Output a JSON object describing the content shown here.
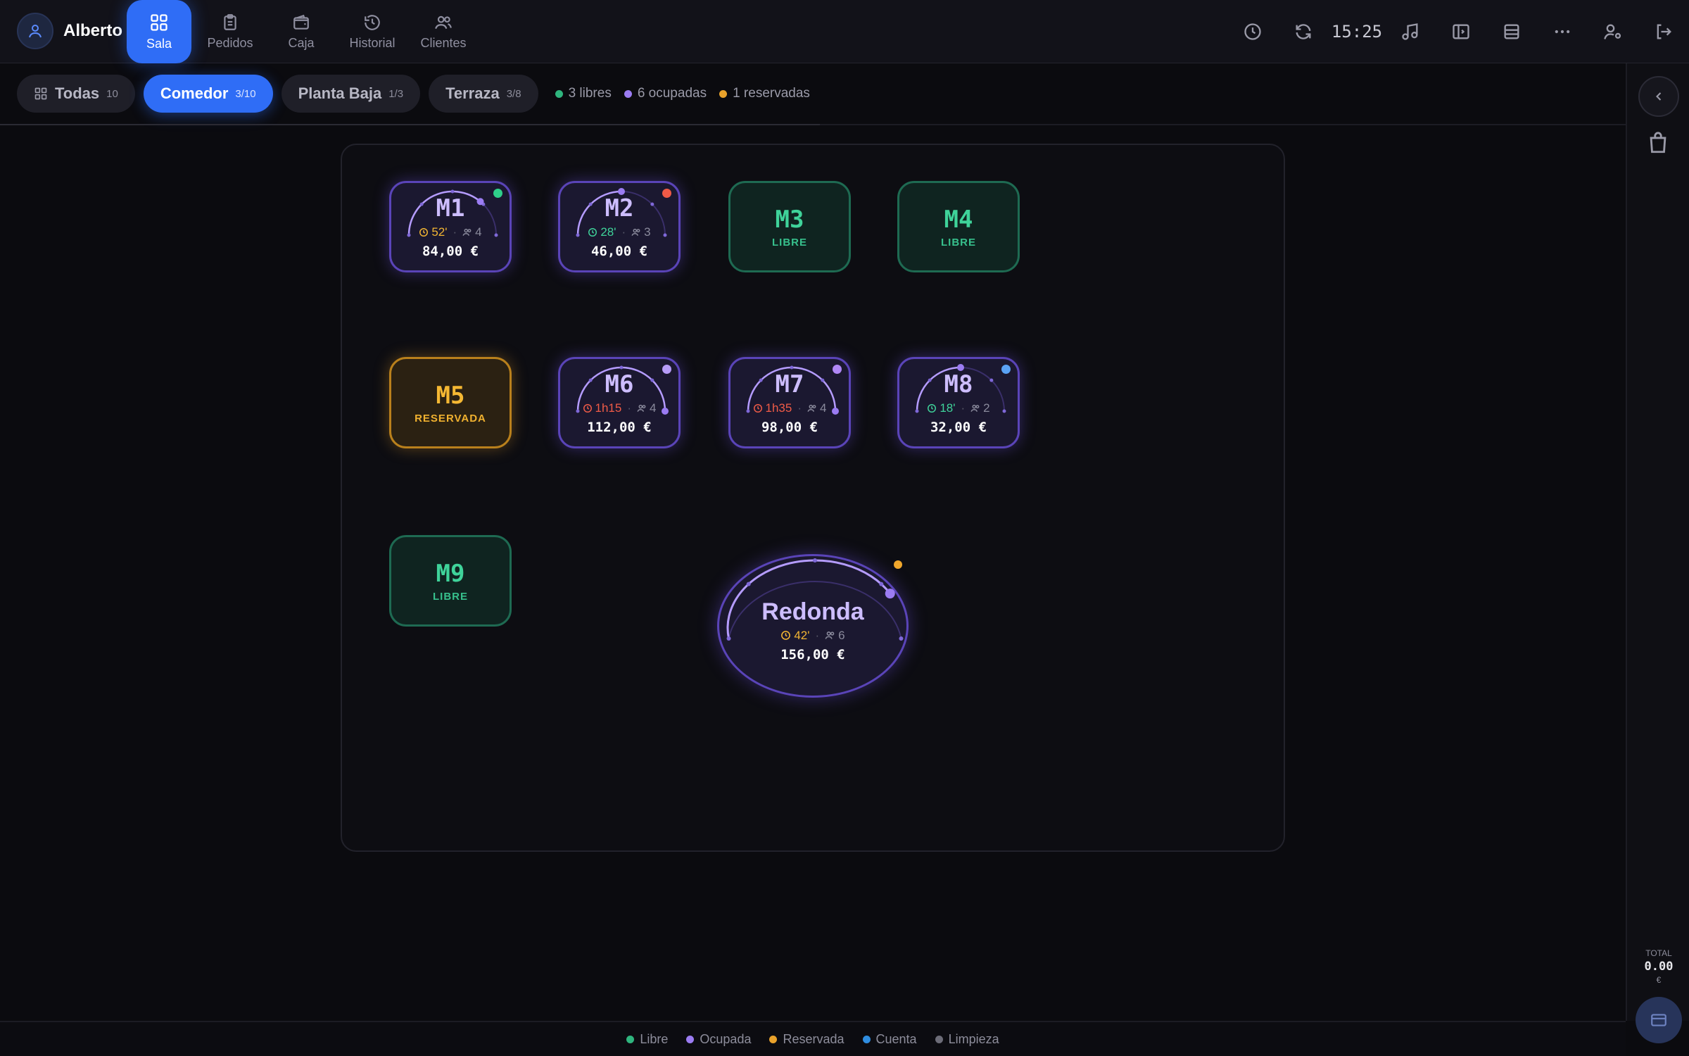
{
  "user": {
    "name": "Alberto"
  },
  "nav": [
    {
      "label": "Sala",
      "icon": "grid-icon",
      "active": true
    },
    {
      "label": "Pedidos",
      "icon": "clipboard-icon"
    },
    {
      "label": "Caja",
      "icon": "wallet-icon"
    },
    {
      "label": "Historial",
      "icon": "history-icon"
    },
    {
      "label": "Clientes",
      "icon": "users-icon"
    }
  ],
  "toolbar": {
    "clock": "15:25"
  },
  "filters": [
    {
      "label": "Todas",
      "count": "10",
      "icon": "grid-icon"
    },
    {
      "label": "Comedor",
      "count": "3/10",
      "active": true
    },
    {
      "label": "Planta Baja",
      "count": "1/3"
    },
    {
      "label": "Terraza",
      "count": "3/8"
    }
  ],
  "summary": {
    "free": "3 libres",
    "occupied": "6 ocupadas",
    "reserved": "1 reservadas"
  },
  "tables": [
    {
      "name": "M1",
      "state": "occupied",
      "time": "52'",
      "guests": "4",
      "price": "84,00 €",
      "time_color": "#f2b533",
      "dot_color": "#2fcf8a",
      "elapsed_fraction": 0.72
    },
    {
      "name": "M2",
      "state": "occupied",
      "time": "28'",
      "guests": "3",
      "price": "46,00 €",
      "time_color": "#3fd39a",
      "dot_color": "#ef5a47",
      "elapsed_fraction": 0.5
    },
    {
      "name": "M3",
      "state": "free",
      "status": "LIBRE"
    },
    {
      "name": "M4",
      "state": "free",
      "status": "LIBRE"
    },
    {
      "name": "M5",
      "state": "reserved",
      "status": "RESERVADA"
    },
    {
      "name": "M6",
      "state": "occupied",
      "time": "1h15",
      "guests": "4",
      "price": "112,00 €",
      "time_color": "#f05b47",
      "dot_color": "#b79cf7",
      "elapsed_fraction": 1.0
    },
    {
      "name": "M7",
      "state": "occupied",
      "time": "1h35",
      "guests": "4",
      "price": "98,00 €",
      "time_color": "#f05b47",
      "dot_color": "#b087f5",
      "elapsed_fraction": 1.0
    },
    {
      "name": "M8",
      "state": "occupied",
      "time": "18'",
      "guests": "2",
      "price": "32,00 €",
      "time_color": "#3fd39a",
      "dot_color": "#5aa2f5",
      "elapsed_fraction": 0.5
    },
    {
      "name": "M9",
      "state": "free",
      "status": "LIBRE"
    }
  ],
  "round_table": {
    "name": "Redonda",
    "time": "42'",
    "guests": "6",
    "price": "156,00 €",
    "time_color": "#f2b533",
    "dot_color": "#f0a72c",
    "elapsed_fraction": 0.8
  },
  "sidebar": {
    "total_label": "TOTAL",
    "total_value": "0.00",
    "currency": "€"
  },
  "legend": [
    {
      "label": "Libre",
      "color": "#2fb57e"
    },
    {
      "label": "Ocupada",
      "color": "#9b7cf2"
    },
    {
      "label": "Reservada",
      "color": "#e9a22b"
    },
    {
      "label": "Cuenta",
      "color": "#2f8de0"
    },
    {
      "label": "Limpieza",
      "color": "#6c6c78"
    }
  ],
  "colors": {
    "accent": "#2f6df6",
    "free": "#2fb57e",
    "occupied": "#9b7cf2",
    "reserved": "#e9a22b"
  }
}
